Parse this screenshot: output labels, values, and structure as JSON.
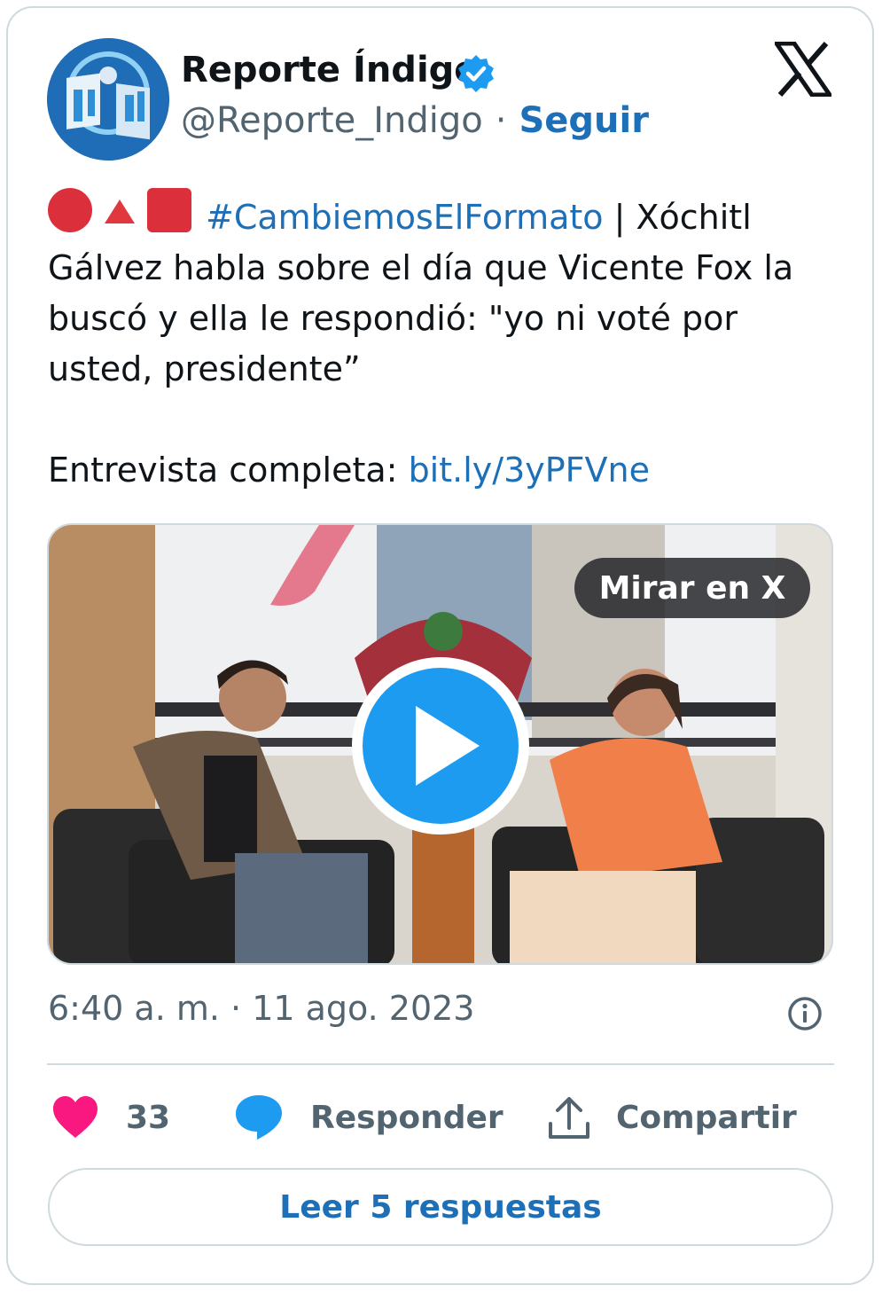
{
  "header": {
    "display_name": "Reporte Índigo",
    "handle": "@Reporte_Indigo",
    "separator": "·",
    "follow_label": "Seguir"
  },
  "tweet": {
    "hashtag": "#CambiemosElFormato",
    "line1_rest": " | Xóchitl Gálvez habla sobre el día que Vicente Fox la buscó y ella le respondió: \"yo ni voté por usted, presidente”",
    "interview_prefix": "Entrevista completa: ",
    "interview_link": "bit.ly/3yPFVne"
  },
  "media": {
    "watch_label": "Mirar en X"
  },
  "meta": {
    "timestamp": "6:40 a. m. · 11 ago. 2023"
  },
  "actions": {
    "like_count": "33",
    "reply_label": "Responder",
    "share_label": "Compartir"
  },
  "footer": {
    "read_replies_label": "Leer 5 respuestas"
  },
  "colors": {
    "link": "#1d6fb8",
    "like": "#f91880",
    "reply": "#1d9bf0",
    "muted": "#536471",
    "border": "#cfd9de"
  },
  "icons": [
    "avatar-logo",
    "verified-badge-icon",
    "x-logo-icon",
    "play-icon",
    "info-icon",
    "heart-icon",
    "speech-bubble-icon",
    "share-icon"
  ]
}
